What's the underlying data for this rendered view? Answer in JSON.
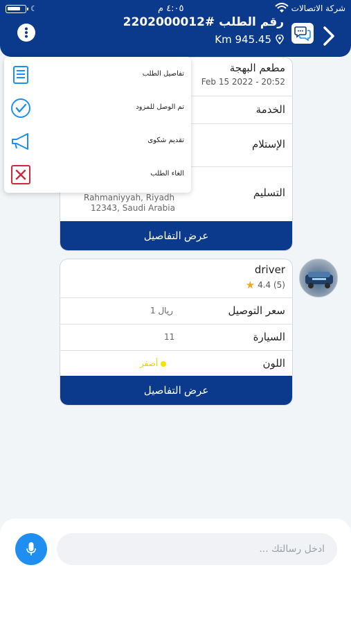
{
  "status_bar": {
    "carrier": "شركة الاتصالات",
    "time": "٤:٠٥ م"
  },
  "header": {
    "order_title": "رقم الطلب #2202000012",
    "distance": "945.45 Km"
  },
  "menu": {
    "items": [
      {
        "label": "تفاصيل الطلب",
        "icon": "document-icon"
      },
      {
        "label": "تم الوصل للمزود",
        "icon": "check-circle-icon"
      },
      {
        "label": "تقديم شكوى",
        "icon": "megaphone-icon"
      },
      {
        "label": "الغاء الطلب",
        "icon": "cancel-icon"
      }
    ]
  },
  "order_card": {
    "restaurant": "مطعم البهجة",
    "date": "Feb 15 2022 - 20:52",
    "service_label": "الخدمة",
    "pickup_label": "الإستلام",
    "delivery_label": "التسليم",
    "delivery_address_line1": "Rahmaniyyah, Riyadh",
    "delivery_address_line2": "12343, Saudi Arabia",
    "details_button": "عرض التفاصيل"
  },
  "driver_card": {
    "name": "driver",
    "rating": "4.4 (5)",
    "fare_label": "سعر التوصيل",
    "fare_value": "1 ريال",
    "car_label": "السيارة",
    "car_value": "11",
    "color_label": "اللون",
    "color_value": "أصفر",
    "details_button": "عرض التفاصيل"
  },
  "composer": {
    "placeholder": "ادخل رسالتك ..."
  },
  "colors": {
    "primary": "#0b3a8c",
    "accent": "#1e8ff0",
    "cancel": "#d0283c"
  }
}
